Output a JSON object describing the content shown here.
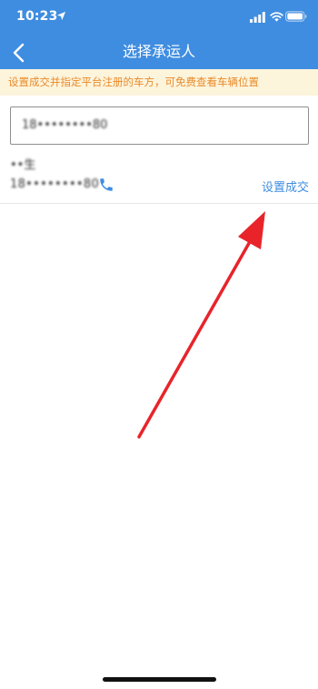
{
  "status_bar": {
    "time": "10:23",
    "location_icon": "location-arrow-icon",
    "signal_icon": "cellular-signal-icon",
    "wifi_icon": "wifi-icon",
    "battery_icon": "battery-icon"
  },
  "header": {
    "back_icon": "chevron-left-icon",
    "title": "选择承运人",
    "background_color": "#3f8de0"
  },
  "notice": {
    "text": "设置成交并指定平台注册的车方，可免费查看车辆位置",
    "background_color": "#fdf4dc",
    "text_color": "#e98b2a"
  },
  "search": {
    "value": "18••••••••80"
  },
  "carriers": [
    {
      "name": "••生",
      "phone": "18••••••••80",
      "phone_icon": "phone-icon",
      "action_label": "设置成交"
    }
  ],
  "annotation": {
    "arrow_color": "#e8242a"
  }
}
